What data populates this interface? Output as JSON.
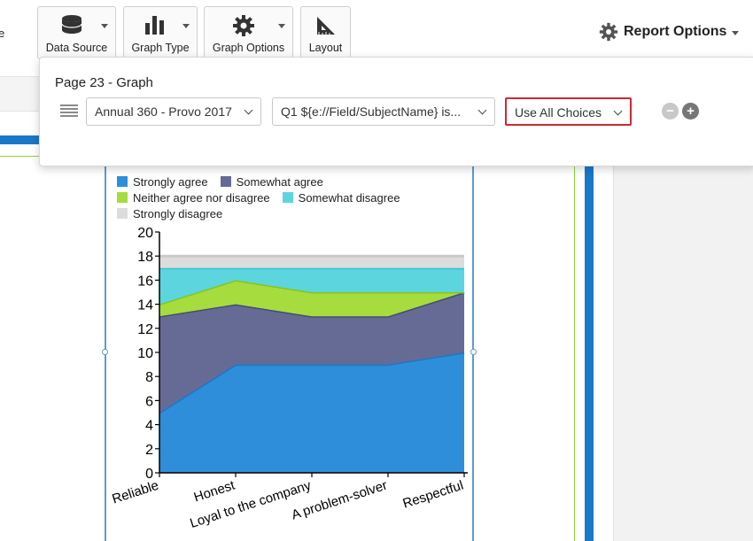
{
  "toolbar": {
    "partial_label": "e",
    "buttons": [
      {
        "label": "Data Source",
        "icon": "database-icon"
      },
      {
        "label": "Graph Type",
        "icon": "bar-chart-icon"
      },
      {
        "label": "Graph Options",
        "icon": "gear-icon"
      },
      {
        "label": "Layout",
        "icon": "set-square-icon"
      }
    ],
    "report_options": {
      "label": "Report Options",
      "icon": "gear-icon"
    }
  },
  "popup": {
    "title": "Page 23 - Graph",
    "data_source_select": "Annual 360 - Provo 2017",
    "question_select": "Q1 ${e://Field/SubjectName} is...",
    "choices_select": "Use All Choices",
    "remove_symbol": "−",
    "add_symbol": "+"
  },
  "colors": {
    "accent_blue": "#1a78c8",
    "highlight_red": "#cc2a32",
    "strongly_agree": "#2f8ed9",
    "somewhat_agree": "#666b95",
    "neither": "#a6dc3e",
    "somewhat_disagree": "#5dd5df",
    "strongly_disagree": "#dcdcdc"
  },
  "chart_data": {
    "type": "area",
    "stacked": true,
    "categories": [
      "Reliable",
      "Honest",
      "Loyal to the company",
      "A problem-solver",
      "Respectful"
    ],
    "series": [
      {
        "name": "Strongly agree",
        "values": [
          5,
          9,
          9,
          9,
          10
        ],
        "color": "#2f8ed9",
        "line": "#1a78c8"
      },
      {
        "name": "Somewhat agree",
        "values": [
          8,
          5,
          4,
          4,
          5
        ],
        "color": "#666b95",
        "line": "#454a78"
      },
      {
        "name": "Neither agree nor disagree",
        "values": [
          1,
          2,
          2,
          2,
          0
        ],
        "color": "#a6dc3e",
        "line": "#86c616"
      },
      {
        "name": "Somewhat disagree",
        "values": [
          3,
          1,
          2,
          2,
          2
        ],
        "color": "#5dd5df",
        "line": "#2bc5d2"
      },
      {
        "name": "Strongly disagree",
        "values": [
          1,
          1,
          1,
          1,
          1
        ],
        "color": "#dcdcdc",
        "line": "#c9c9c9"
      }
    ],
    "legend_rows": [
      [
        0,
        1
      ],
      [
        2,
        3
      ],
      [
        4
      ]
    ],
    "ylim": [
      0,
      20
    ],
    "yticks": [
      0,
      2,
      4,
      6,
      8,
      10,
      12,
      14,
      16,
      18,
      20
    ],
    "legend_position": "top",
    "grid": false
  }
}
